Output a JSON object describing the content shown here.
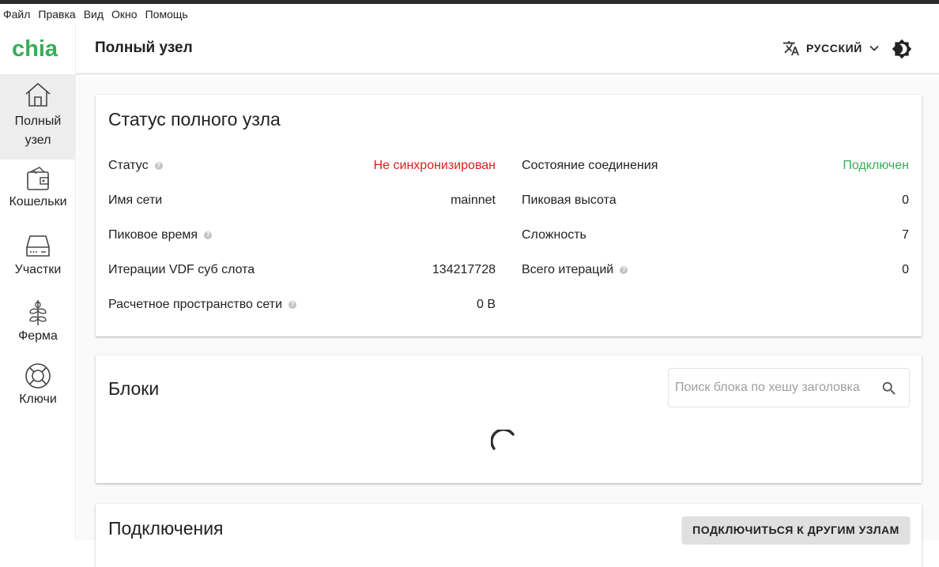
{
  "menu": [
    "Файл",
    "Правка",
    "Вид",
    "Окно",
    "Помощь"
  ],
  "app": {
    "logo_text": "chia",
    "brand_color": "#3aac59"
  },
  "sidebar": {
    "items": [
      {
        "label": "Полный узел",
        "icon": "home-icon",
        "active": true
      },
      {
        "label": "Кошельки",
        "icon": "wallet-icon"
      },
      {
        "label": "Участки",
        "icon": "hard-drive-icon"
      },
      {
        "label": "Ферма",
        "icon": "sprout-icon"
      },
      {
        "label": "Ключи",
        "icon": "lifebuoy-icon"
      }
    ]
  },
  "header": {
    "title": "Полный узел",
    "language": "РУССКИЙ",
    "language_icon": "translate-icon",
    "theme_icon": "brightness-icon"
  },
  "status_card": {
    "title": "Статус полного узла",
    "left": [
      {
        "label": "Статус",
        "value": "Не синхронизирован",
        "help": true,
        "color": "#e01b1b"
      },
      {
        "label": "Имя сети",
        "value": "mainnet",
        "help": false
      },
      {
        "label": "Пиковое время",
        "value": "",
        "help": true
      },
      {
        "label": "Итерации VDF суб слота",
        "value": "134217728",
        "help": false
      },
      {
        "label": "Расчетное пространство сети",
        "value": "0 B",
        "help": true
      }
    ],
    "right": [
      {
        "label": "Состояние соединения",
        "value": "Подключен",
        "help": false,
        "color": "#3aac59"
      },
      {
        "label": "Пиковая высота",
        "value": "0",
        "help": false
      },
      {
        "label": "Сложность",
        "value": "7",
        "help": false
      },
      {
        "label": "Всего итераций",
        "value": "0",
        "help": true
      }
    ]
  },
  "blocks_card": {
    "title": "Блоки",
    "search_placeholder": "Поиск блока по хешу заголовка",
    "loading": true
  },
  "connections_card": {
    "title": "Подключения",
    "connect_button": "ПОДКЛЮЧИТЬСЯ К ДРУГИМ УЗЛАМ"
  }
}
